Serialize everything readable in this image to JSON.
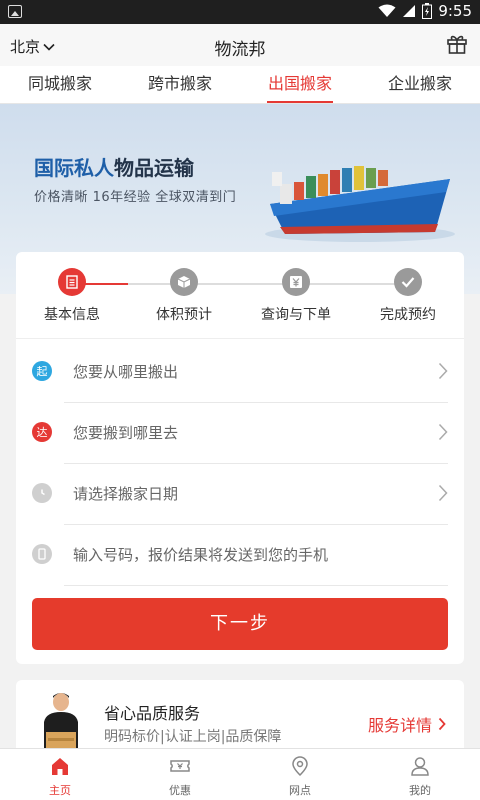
{
  "status_bar": {
    "time": "9:55"
  },
  "header": {
    "city": "北京",
    "title": "物流邦"
  },
  "tabs": [
    {
      "label": "同城搬家",
      "active": false
    },
    {
      "label": "跨市搬家",
      "active": false
    },
    {
      "label": "出国搬家",
      "active": true
    },
    {
      "label": "企业搬家",
      "active": false
    }
  ],
  "banner": {
    "headline_blue": "国际私人",
    "headline_dark": "物品运输",
    "subtitle": "价格清晰   16年经验   全球双清到门"
  },
  "steps": [
    {
      "label": "基本信息",
      "icon": "document-icon",
      "active": true
    },
    {
      "label": "体积预计",
      "icon": "box-icon",
      "active": false
    },
    {
      "label": "查询与下单",
      "icon": "yen-icon",
      "active": false
    },
    {
      "label": "完成预约",
      "icon": "check-icon",
      "active": false
    }
  ],
  "form": {
    "from": {
      "badge": "起",
      "placeholder": "您要从哪里搬出"
    },
    "to": {
      "badge": "达",
      "placeholder": "您要搬到哪里去"
    },
    "date": {
      "placeholder": "请选择搬家日期"
    },
    "phone": {
      "placeholder": "输入号码，报价结果将发送到您的手机"
    },
    "next_label": "下一步"
  },
  "service": {
    "title": "省心品质服务",
    "subtitle": "明码标价|认证上岗|品质保障",
    "link": "服务详情"
  },
  "bottom_nav": [
    {
      "label": "主页",
      "icon": "home-icon",
      "active": true
    },
    {
      "label": "优惠",
      "icon": "coupon-icon",
      "active": false
    },
    {
      "label": "网点",
      "icon": "location-icon",
      "active": false
    },
    {
      "label": "我的",
      "icon": "user-icon",
      "active": false
    }
  ],
  "colors": {
    "accent": "#e53935",
    "button": "#e53b2c",
    "from_badge": "#2ea7e0",
    "banner_title": "#1e5fa8"
  }
}
